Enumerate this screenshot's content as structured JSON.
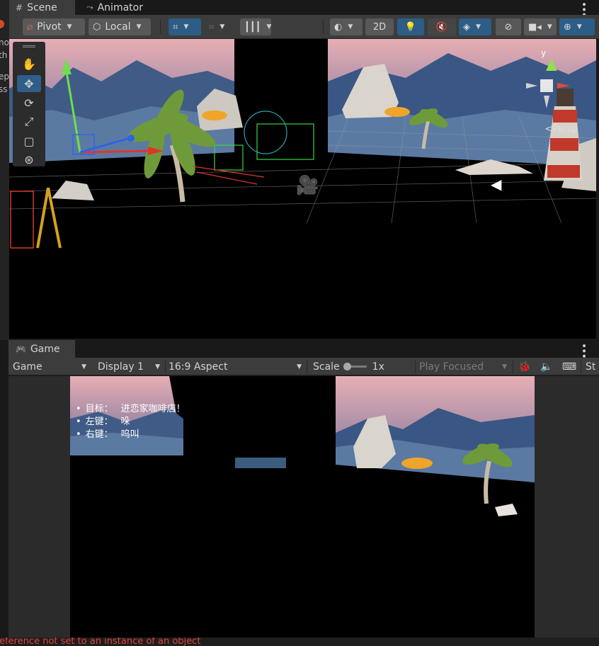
{
  "scene_tabs": [
    {
      "icon": "grid-icon",
      "label": "Scene"
    },
    {
      "icon": "animator-icon",
      "label": "Animator"
    }
  ],
  "scene_toolbar": {
    "pivot_label": "Pivot",
    "local_label": "Local",
    "mode_2d_label": "2D"
  },
  "scene_view": {
    "perspective_label": "<Persp",
    "gizmo_axis_label": "y"
  },
  "left_strip_text": [
    "no",
    "th",
    "ep",
    "ss"
  ],
  "game_tab": {
    "label": "Game"
  },
  "game_toolbar": {
    "view_select": "Game",
    "display_select": "Display 1",
    "aspect_select": "16:9 Aspect",
    "scale_label": "Scale",
    "scale_value": "1x",
    "play_focused_select": "Play Focused",
    "last_item": "St"
  },
  "hud": {
    "items": [
      {
        "key": "目标：",
        "value": "进恋家咖啡店！"
      },
      {
        "key": "左键：",
        "value": "哚"
      },
      {
        "key": "右键：",
        "value": "呜叫"
      }
    ]
  },
  "console": {
    "message": "reference not set to an instance of an object"
  },
  "colors": {
    "accent_blue": "#2c5d87",
    "error_red": "#e0453a",
    "sky_top": "#e7aeb4",
    "sky_bottom": "#6e6f9b"
  }
}
